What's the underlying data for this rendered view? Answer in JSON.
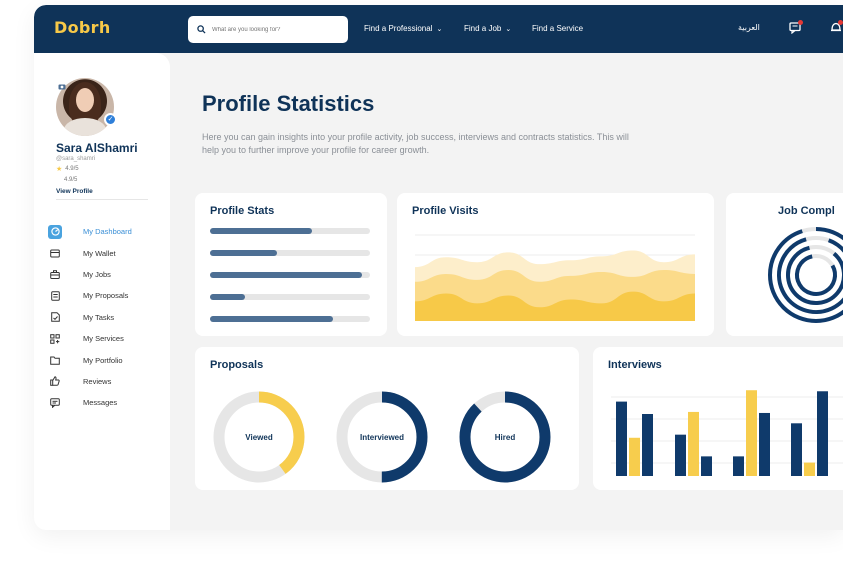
{
  "brand": {
    "logo": "Dobrh"
  },
  "topbar": {
    "search_placeholder": "What are you looking for?",
    "nav": [
      "Find a Professional",
      "Find a Job",
      "Find a Service"
    ],
    "language": "العربية"
  },
  "profile": {
    "name": "Sara AlShamri",
    "handle": "@sara_shamri",
    "rating_1": "4.9/5",
    "rating_2": "4.9/5",
    "view_profile": "View Profile"
  },
  "sidebar": {
    "items": [
      {
        "label": "My Dashboard",
        "icon": "dashboard-icon",
        "active": true
      },
      {
        "label": "My Wallet",
        "icon": "wallet-icon"
      },
      {
        "label": "My Jobs",
        "icon": "briefcase-icon"
      },
      {
        "label": "My Proposals",
        "icon": "proposals-icon"
      },
      {
        "label": "My Tasks",
        "icon": "tasks-icon"
      },
      {
        "label": "My Services",
        "icon": "services-icon"
      },
      {
        "label": "My Portfolio",
        "icon": "folder-icon"
      },
      {
        "label": "Reviews",
        "icon": "thumbs-up-icon"
      },
      {
        "label": "Messages",
        "icon": "message-icon"
      }
    ]
  },
  "page": {
    "title": "Profile Statistics",
    "description": "Here you can gain insights into your profile activity, job success, interviews and contracts statistics. This will help you to further improve your profile for career growth."
  },
  "cards": {
    "profile_stats": {
      "title": "Profile Stats",
      "bars": [
        0.64,
        0.42,
        0.95,
        0.22,
        0.77
      ]
    },
    "profile_visits": {
      "title": "Profile Visits"
    },
    "job_completion": {
      "title": "Job Compl",
      "rings": [
        0.95,
        0.9,
        0.85,
        0.8
      ]
    },
    "proposals": {
      "title": "Proposals",
      "donuts": [
        {
          "label": "Viewed",
          "value": 0.4,
          "color": "#f7cd4d"
        },
        {
          "label": "Interviewed",
          "value": 0.5,
          "color": "#0f3a6b"
        },
        {
          "label": "Hired",
          "value": 0.88,
          "color": "#0f3a6b"
        }
      ]
    },
    "interviews": {
      "title": "Interviews"
    }
  },
  "chart_data": [
    {
      "type": "area",
      "title": "Profile Visits",
      "series": [
        {
          "values": [
            55,
            65,
            60,
            70,
            58,
            62,
            66,
            72,
            60,
            68
          ],
          "color": "#fdeecb"
        },
        {
          "values": [
            40,
            48,
            42,
            52,
            40,
            46,
            50,
            45,
            52,
            48
          ],
          "color": "#fbdb8a"
        },
        {
          "values": [
            20,
            28,
            18,
            26,
            14,
            22,
            18,
            30,
            20,
            28
          ],
          "color": "#f7c948"
        }
      ],
      "ylim": [
        0,
        100
      ]
    },
    {
      "type": "bar",
      "title": "Interviews",
      "groups": [
        {
          "navy": 72,
          "yellow": 37,
          "navy2": 60
        },
        {
          "navy": 40,
          "yellow": 62,
          "navy2": 19
        },
        {
          "navy": 19,
          "yellow": 83,
          "navy2": 61
        },
        {
          "navy": 51,
          "yellow": 13,
          "navy2": 82
        }
      ],
      "ylim": [
        0,
        90
      ],
      "colors": {
        "navy": "#0f3a6b",
        "yellow": "#f7cd4d"
      }
    }
  ]
}
